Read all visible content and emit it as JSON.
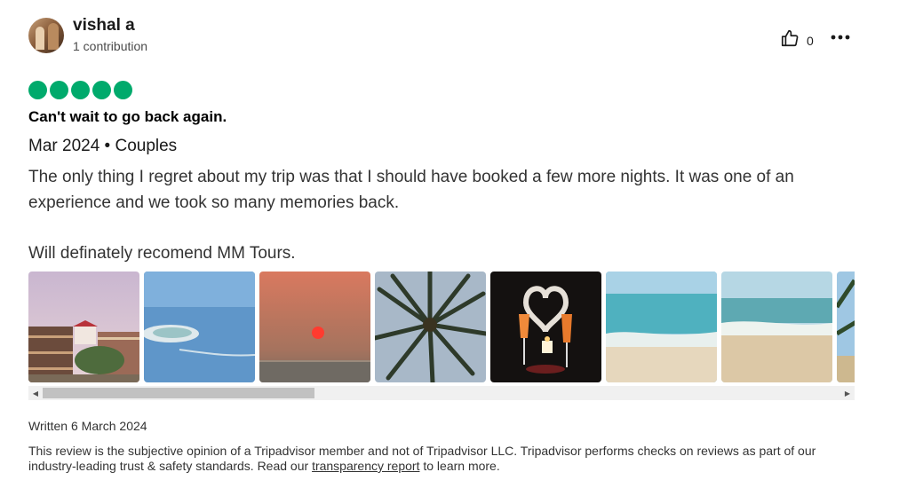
{
  "author": {
    "name": "vishal a",
    "contributions": "1 contribution",
    "avatar": "avatar"
  },
  "actions": {
    "helpful_icon": "thumbs-up-icon",
    "helpful_count": "0",
    "more_icon": "more-options-icon"
  },
  "review": {
    "rating": 5,
    "rating_max": 5,
    "rating_color": "#00aa6c",
    "title": "Can't wait to go back again.",
    "meta": "Mar 2024 • Couples",
    "body": "The only thing I regret about my trip was that I should have booked a few more nights. It was one of an experience and we took so many memories back.\n\nWill definately recomend MM Tours.",
    "written": "Written 6 March 2024"
  },
  "photos": [
    {
      "name": "hotel-building-photo"
    },
    {
      "name": "island-aerial-photo"
    },
    {
      "name": "sunset-sea-photo"
    },
    {
      "name": "palm-tree-photo"
    },
    {
      "name": "candlelight-drinks-photo"
    },
    {
      "name": "beach-waves-photo"
    },
    {
      "name": "sandy-beach-photo"
    },
    {
      "name": "palm-beach-photo"
    }
  ],
  "scrollbar": {
    "left_icon": "scroll-left-icon",
    "right_icon": "scroll-right-icon",
    "position": 0
  },
  "disclaimer": {
    "before": "This review is the subjective opinion of a Tripadvisor member and not of Tripadvisor LLC. Tripadvisor performs checks on reviews as part of our industry-leading trust & safety standards. Read our ",
    "link": "transparency report",
    "after": " to learn more."
  }
}
